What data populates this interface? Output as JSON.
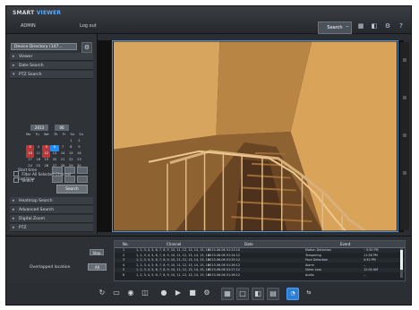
{
  "app": {
    "brand_left": "SMART",
    "brand_right": "VIEWER",
    "user": "ADMIN",
    "logout": "Log out",
    "search_tab": "Search"
  },
  "sidebar": {
    "device": "Device Directory (147...",
    "items": [
      {
        "label": "Viewer",
        "open": false
      },
      {
        "label": "Date Search",
        "open": false
      },
      {
        "label": "PTZ Search",
        "open": true
      },
      {
        "label": "Heatmap Search",
        "open": false
      },
      {
        "label": "Advanced Search",
        "open": false
      },
      {
        "label": "Digital Zoom",
        "open": false
      },
      {
        "label": "PTZ",
        "open": false
      }
    ],
    "calendar": {
      "month": "2013",
      "year": "06",
      "dows": [
        "Mo",
        "Tu",
        "We",
        "Th",
        "Fr",
        "Sa",
        "Su"
      ],
      "days": [
        "",
        "",
        "",
        "",
        "",
        "1",
        "2",
        "3",
        "4",
        "5",
        "6",
        "7",
        "8",
        "9",
        "10",
        "11",
        "12",
        "13",
        "14",
        "15",
        "16",
        "17",
        "18",
        "19",
        "20",
        "21",
        "22",
        "23",
        "24",
        "25",
        "26",
        "27",
        "28",
        "29",
        "30"
      ]
    },
    "time_rows": [
      {
        "label": "Start time"
      },
      {
        "label": "End time"
      }
    ],
    "label_color": "#cfd4da",
    "opt1": "Filter All Selected Channel",
    "opt2": "Select",
    "search_button": "Search"
  },
  "lower": {
    "stop_label": "Stop",
    "label": "Overlapped location",
    "combo_value": "All",
    "columns": [
      "No.",
      "Channel",
      "Date",
      "Event"
    ],
    "rows": [
      {
        "no": "1",
        "channel": "1, 2, 3, 4, 5, 6, 7, 8, 9, 10, 11, 12, 13, 14, 15, 16",
        "date": "2013-06-06 01:23:10",
        "event": "Motion Detection",
        "extra": "~3:30 PM"
      },
      {
        "no": "2",
        "channel": "1, 2, 3, 4, 5, 6, 7, 8, 9, 10, 11, 12, 13, 14, 15, 16",
        "date": "2013-06-06 01:24:12",
        "event": "Tampering",
        "extra": "11:56 PM"
      },
      {
        "no": "3",
        "channel": "1, 2, 3, 4, 5, 6, 7, 8, 9, 10, 11, 12, 13, 14, 15, 16",
        "date": "2013-06-06 01:25:12",
        "event": "Face Detection",
        "extra": "4:30 PM"
      },
      {
        "no": "4",
        "channel": "1, 2, 3, 4, 5, 6, 7, 8, 9, 10, 11, 12, 13, 14, 15, 16",
        "date": "2013-06-06 01:26:12",
        "event": "Alarm",
        "extra": "--"
      },
      {
        "no": "5",
        "channel": "1, 2, 3, 4, 5, 6, 7, 8, 9, 10, 11, 12, 13, 14, 15, 16",
        "date": "2013-06-06 01:27:12",
        "event": "Video Loss",
        "extra": "12:00 AM"
      },
      {
        "no": "6",
        "channel": "1, 2, 3, 4, 5, 6, 7, 8, 9, 10, 11, 12, 13, 14, 15, 16",
        "date": "2013-06-06 01:28:12",
        "event": "Audio",
        "extra": "--"
      }
    ]
  },
  "toolbar": {
    "icons": [
      "refresh-icon",
      "monitor-icon",
      "camera-icon",
      "screen-icon",
      "record-icon",
      "play-icon",
      "stop-icon",
      "settings-icon",
      "grid-icon",
      "single-view-icon",
      "double-view-icon",
      "panel-view-icon",
      "speaker-icon",
      "left-right-icon"
    ]
  }
}
